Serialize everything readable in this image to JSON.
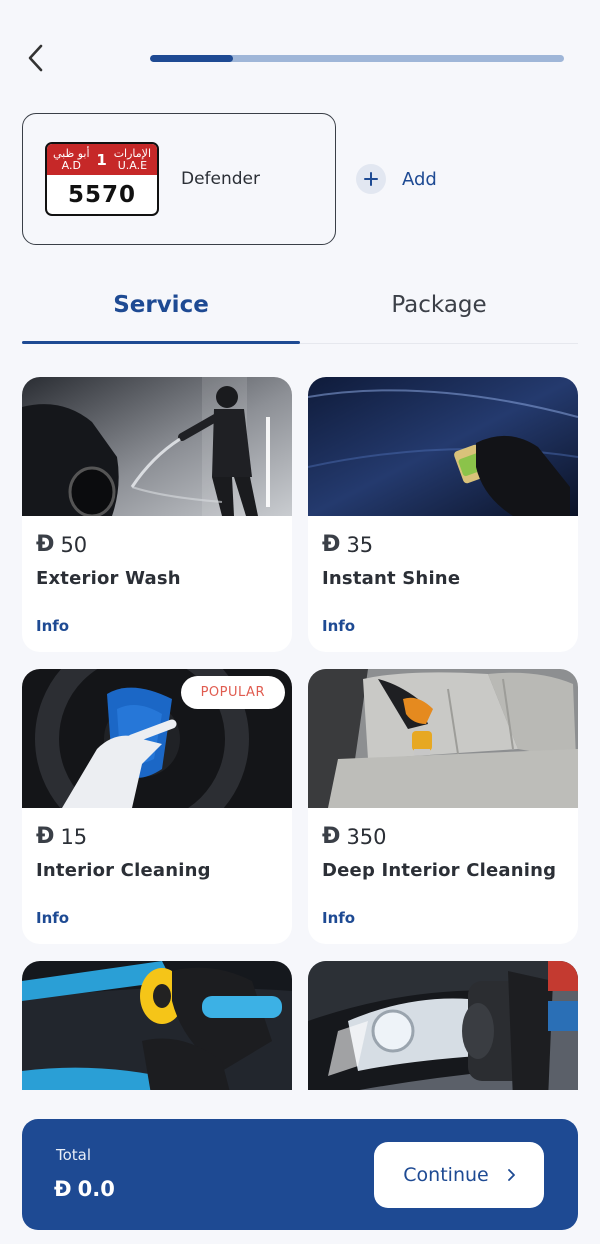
{
  "header": {
    "back_icon": "chevron-left-icon",
    "progress_fraction": 0.2
  },
  "vehicle": {
    "plate": {
      "emirate_arabic": "أبو ظبي",
      "emirate_code": "A.D",
      "category": "1",
      "country_arabic": "الإمارات",
      "country_code": "U.A.E",
      "number": "5570",
      "band_color": "#c62828"
    },
    "name": "Defender"
  },
  "add": {
    "label": "Add",
    "icon": "plus-icon"
  },
  "tabs": [
    {
      "label": "Service",
      "active": true
    },
    {
      "label": "Package",
      "active": false
    }
  ],
  "currency_symbol": "Đ",
  "services": [
    {
      "price": "50",
      "title": "Exterior Wash",
      "info": "Info",
      "image": "car-wash-photo"
    },
    {
      "price": "35",
      "title": "Instant Shine",
      "info": "Info",
      "image": "car-polish-photo"
    },
    {
      "price": "15",
      "title": "Interior Cleaning",
      "info": "Info",
      "badge": "POPULAR",
      "image": "steering-wheel-cleaning-photo"
    },
    {
      "price": "350",
      "title": "Deep Interior Cleaning",
      "info": "Info",
      "image": "seat-cleaning-photo"
    },
    {
      "image": "buffer-polishing-photo"
    },
    {
      "image": "headlight-polishing-photo"
    }
  ],
  "footer": {
    "total_label": "Total",
    "total_value": "0.0",
    "continue_label": "Continue",
    "continue_icon": "chevron-right-icon"
  },
  "colors": {
    "primary": "#1e4a93",
    "progress_track": "#9fb6d8",
    "badge_text": "#e05c50",
    "background": "#f6f7fb"
  }
}
